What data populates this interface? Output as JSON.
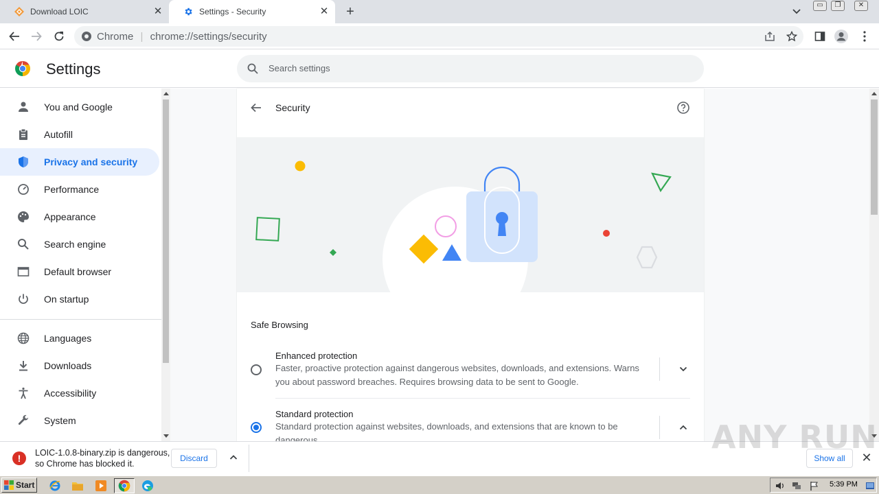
{
  "browser": {
    "tabs": [
      {
        "title": "Download LOIC",
        "icon": "loic-favicon-icon"
      },
      {
        "title": "Settings - Security",
        "icon": "settings-gear-icon",
        "active": true
      }
    ],
    "address": {
      "scheme_label": "Chrome",
      "url": "chrome://settings/security"
    }
  },
  "settings": {
    "title": "Settings",
    "search_placeholder": "Search settings",
    "nav": [
      {
        "label": "You and Google",
        "icon": "person-icon"
      },
      {
        "label": "Autofill",
        "icon": "clipboard-icon"
      },
      {
        "label": "Privacy and security",
        "icon": "shield-icon",
        "active": true
      },
      {
        "label": "Performance",
        "icon": "speedometer-icon"
      },
      {
        "label": "Appearance",
        "icon": "palette-icon"
      },
      {
        "label": "Search engine",
        "icon": "search-icon"
      },
      {
        "label": "Default browser",
        "icon": "browser-window-icon"
      },
      {
        "label": "On startup",
        "icon": "power-icon"
      },
      {
        "label": "Languages",
        "icon": "globe-icon"
      },
      {
        "label": "Downloads",
        "icon": "download-icon"
      },
      {
        "label": "Accessibility",
        "icon": "accessibility-icon"
      },
      {
        "label": "System",
        "icon": "wrench-icon"
      }
    ],
    "page": {
      "title": "Security",
      "section_title": "Safe Browsing",
      "options": [
        {
          "title": "Enhanced protection",
          "description": "Faster, proactive protection against dangerous websites, downloads, and extensions. Warns you about password breaches. Requires browsing data to be sent to Google.",
          "selected": false,
          "expanded": false
        },
        {
          "title": "Standard protection",
          "description": "Standard protection against websites, downloads, and extensions that are known to be dangerous.",
          "selected": true,
          "expanded": true
        }
      ]
    }
  },
  "download_bar": {
    "message_line1": "LOIC-1.0.8-binary.zip is dangerous,",
    "message_line2": "so Chrome has blocked it.",
    "discard_label": "Discard",
    "show_all_label": "Show all"
  },
  "watermark": "ANY RUN",
  "taskbar": {
    "start_label": "Start",
    "clock": "5:39 PM"
  },
  "colors": {
    "accent": "#1a73e8",
    "active_nav_bg": "#e8f0fe",
    "danger": "#d93025"
  }
}
